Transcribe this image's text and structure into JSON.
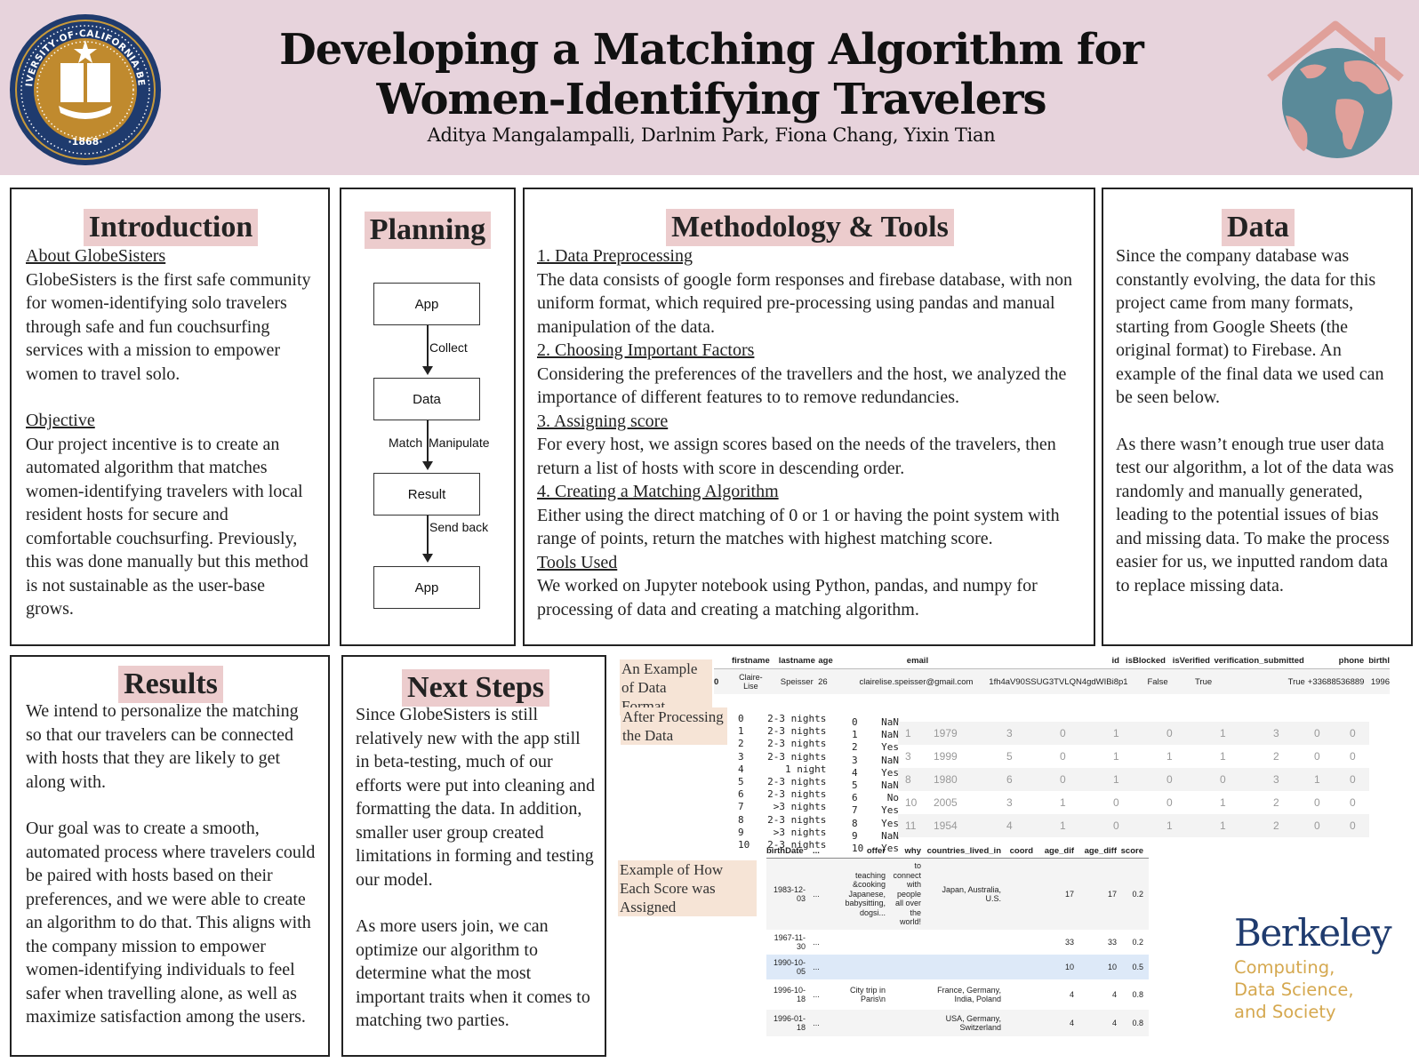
{
  "header": {
    "title_line1": "Developing a Matching Algorithm for",
    "title_line2": "Women-Identifying Travelers",
    "authors": "Aditya Mangalampalli, Darlnim Park, Fiona Chang, Yixin Tian",
    "left_logo": "uc-berkeley-seal",
    "left_logo_text": "THE UNIVERSITY OF CALIFORNIA BERKELEY 1868",
    "right_logo": "globe-house-logo"
  },
  "colors": {
    "header_bg": "#e7d3dc",
    "title_highlight": "#eccccd",
    "label_highlight": "#f6e4d6",
    "berkeley_blue": "#1f3b6e",
    "berkeley_gold": "#d5a84f",
    "globe_teal": "#5a8a99",
    "globe_pink": "#e0a09a"
  },
  "introduction": {
    "title": "Introduction",
    "about_heading": "About GlobeSisters",
    "about_text": "GlobeSisters is the first safe community for women-identifying solo travelers through safe and fun couchsurfing services with a mission to empower women to travel solo.",
    "objective_heading": "Objective",
    "objective_text": "Our project incentive is to create an automated algorithm that matches women-identifying travelers with local resident hosts for secure and comfortable couchsurfing. Previously, this was done manually but this method is not sustainable as the user-base grows."
  },
  "planning": {
    "title": "Planning",
    "nodes": [
      "App",
      "Data",
      "Result",
      "App"
    ],
    "edges": [
      {
        "label": "Collect"
      },
      {
        "label_left": "Match",
        "label_right": "Manipulate"
      },
      {
        "label": "Send back"
      }
    ]
  },
  "methodology": {
    "title": "Methodology & Tools",
    "sections": [
      {
        "heading": "1. Data Preprocessing",
        "text": "The data consists of google form responses and firebase database, with non uniform format, which required pre-processing using pandas and manual manipulation of the data."
      },
      {
        "heading": "2. Choosing Important Factors",
        "text": "Considering the preferences of the travellers and the host, we analyzed the importance of different features to to remove redundancies."
      },
      {
        "heading": "3. Assigning score",
        "text": "For every host, we assign scores based on the needs of the travelers, then return a list of hosts with score in descending order."
      },
      {
        "heading": "4. Creating a Matching Algorithm",
        "text": "Either using the direct matching of 0 or 1 or having the point system with range of points, return the matches with highest matching score."
      },
      {
        "heading": "Tools Used",
        "text": "We worked on Jupyter notebook using Python, pandas, and numpy for processing of data and creating a matching algorithm."
      }
    ]
  },
  "data_panel": {
    "title": "Data",
    "para1": "Since the company database was constantly evolving, the data for this project came from many formats, starting from Google Sheets (the original format) to Firebase. An example of the final data we used can be seen below.",
    "para2": "As there wasn’t enough true user data test our algorithm, a lot of the data was randomly and manually generated, leading to the potential issues of bias and missing data. To make the process easier for us, we inputted random data to replace missing data."
  },
  "results": {
    "title": "Results",
    "para1": "We intend to personalize the matching so that our travelers can be connected with hosts that they are likely to get along with.",
    "para2": "Our goal was to create a smooth, automated process where travelers could be paired with hosts based on their preferences, and we were able to create an algorithm to do that. This aligns with the company mission to empower women-identifying individuals to feel safer when travelling alone, as well as maximize satisfaction among the users."
  },
  "next_steps": {
    "title": "Next Steps",
    "para1": "Since GlobeSisters is still relatively new with the app still in beta-testing, much of our efforts were put into cleaning and formatting the data. In addition,  smaller user group created limitations in forming and testing our model.",
    "para2": "As more users join, we can optimize our algorithm to determine what the most important traits when it comes to matching two parties."
  },
  "examples": {
    "label_format": "An Example of Data Format",
    "label_processing": "After  Processing the Data",
    "label_score": "Example of How Each Score was Assigned",
    "raw_table": {
      "columns": [
        "",
        "firstname",
        "lastname",
        "age",
        "email",
        "id",
        "isBlocked",
        "isVerified",
        "verification_submitted",
        "phone",
        "birthl"
      ],
      "rows": [
        [
          "0",
          "Claire-Lise",
          "Speisser",
          "26",
          "clairelise.speisser@gmail.com",
          "1fh4aV90SSUG3TVLQN4gdWIBi8p1",
          "False",
          "True",
          "True",
          "+33688536889",
          "1996"
        ]
      ]
    },
    "nights_series": [
      [
        "0",
        "2-3 nights"
      ],
      [
        "1",
        "2-3 nights"
      ],
      [
        "2",
        "2-3 nights"
      ],
      [
        "3",
        "2-3 nights"
      ],
      [
        "4",
        "1 night"
      ],
      [
        "5",
        "2-3 nights"
      ],
      [
        "6",
        "2-3 nights"
      ],
      [
        "7",
        ">3 nights"
      ],
      [
        "8",
        "2-3 nights"
      ],
      [
        "9",
        ">3 nights"
      ],
      [
        "10",
        "2-3 nights"
      ]
    ],
    "yesno_series": [
      [
        "0",
        "NaN"
      ],
      [
        "1",
        "NaN"
      ],
      [
        "2",
        "Yes"
      ],
      [
        "3",
        "NaN"
      ],
      [
        "4",
        "Yes"
      ],
      [
        "5",
        "NaN"
      ],
      [
        "6",
        "No"
      ],
      [
        "7",
        "Yes"
      ],
      [
        "8",
        "Yes"
      ],
      [
        "9",
        "NaN"
      ],
      [
        "10",
        "Yes"
      ]
    ],
    "encoded_table": {
      "rows": [
        [
          "1",
          "1979",
          "3",
          "0",
          "1",
          "0",
          "1",
          "3",
          "0",
          "0"
        ],
        [
          "3",
          "1999",
          "5",
          "0",
          "1",
          "1",
          "1",
          "2",
          "0",
          "0"
        ],
        [
          "8",
          "1980",
          "6",
          "0",
          "1",
          "0",
          "0",
          "3",
          "1",
          "0"
        ],
        [
          "10",
          "2005",
          "3",
          "1",
          "0",
          "0",
          "1",
          "2",
          "0",
          "0"
        ],
        [
          "11",
          "1954",
          "4",
          "1",
          "0",
          "1",
          "1",
          "2",
          "0",
          "0"
        ]
      ]
    },
    "score_table": {
      "columns": [
        "birthDate",
        "...",
        "offer",
        "why",
        "countries_lived_in",
        "coord",
        "age_dif",
        "age_diff",
        "score"
      ],
      "rows": [
        [
          "1983-12-03",
          "...",
          "teaching &cooking Japanese, babysitting, dogsi...",
          "to connect with people all over the world!",
          "Japan, Australia, U.S.",
          "",
          "17",
          "17",
          "0.2"
        ],
        [
          "1967-11-30",
          "...",
          "",
          "",
          "",
          "",
          "33",
          "33",
          "0.2"
        ],
        [
          "1990-10-05",
          "...",
          "",
          "",
          "",
          "",
          "10",
          "10",
          "0.5"
        ],
        [
          "1996-10-18",
          "...",
          "City trip in Paris\\n",
          "",
          "France, Germany, India, Poland",
          "",
          "4",
          "4",
          "0.8"
        ],
        [
          "1996-01-18",
          "...",
          "",
          "",
          "USA, Germany, Switzerland",
          "",
          "4",
          "4",
          "0.8"
        ]
      ],
      "highlighted_row": 2
    }
  },
  "footer_logo": {
    "wordmark": "Berkeley",
    "line1": "Computing,",
    "line2": "Data Science,",
    "line3": "and Society"
  }
}
